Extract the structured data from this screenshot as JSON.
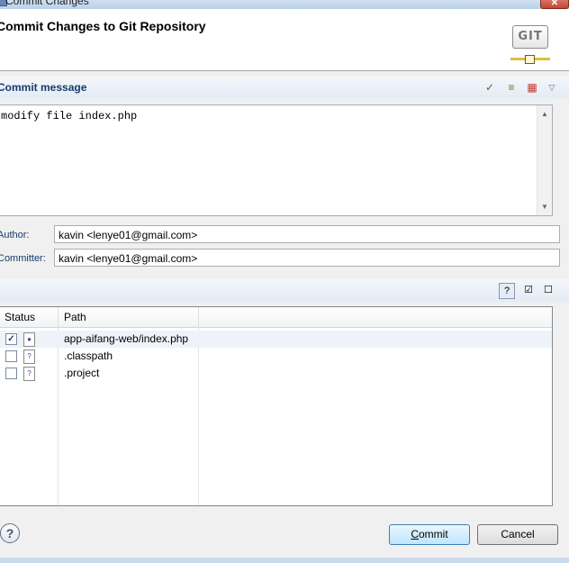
{
  "window": {
    "title": "Commit Changes"
  },
  "header": {
    "title": "Commit Changes to Git Repository",
    "logo_text": "GIT"
  },
  "commit_message": {
    "section_label": "Commit message",
    "value": "modify file index.php"
  },
  "author": {
    "label": "Author:",
    "value": "kavin <lenye01@gmail.com>"
  },
  "committer": {
    "label": "Committer:",
    "value": "kavin <lenye01@gmail.com>"
  },
  "files_table": {
    "columns": [
      "Status",
      "Path"
    ],
    "rows": [
      {
        "checked": true,
        "status_icon": "modified-file-icon",
        "path": "app-aifang-web/index.php"
      },
      {
        "checked": false,
        "status_icon": "untracked-file-icon",
        "path": ".classpath"
      },
      {
        "checked": false,
        "status_icon": "untracked-file-icon",
        "path": ".project"
      }
    ]
  },
  "buttons": {
    "commit_mnemonic": "C",
    "commit_rest": "ommit",
    "cancel": "Cancel"
  },
  "icons": {
    "help": "?"
  }
}
